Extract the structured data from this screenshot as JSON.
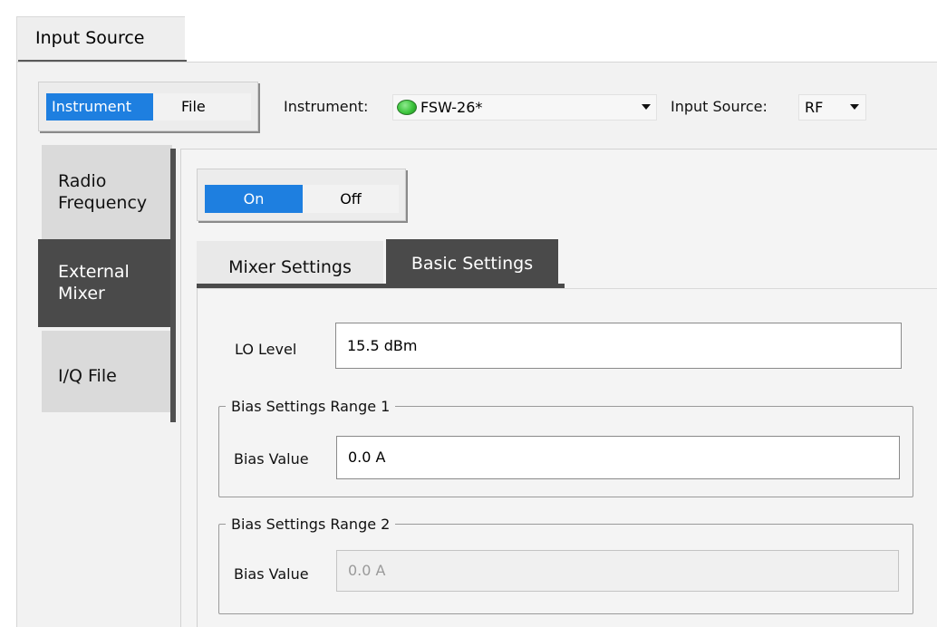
{
  "window": {
    "main_tab": "Input Source"
  },
  "source_toggle": {
    "options": [
      "Instrument",
      "File"
    ],
    "selected": "Instrument"
  },
  "instrument_select": {
    "label": "Instrument:",
    "value": "FSW-26*",
    "status_color": "#3cc43c"
  },
  "input_source_select": {
    "label": "Input Source:",
    "value": "RF"
  },
  "side_tabs": [
    {
      "label_line1": "Radio",
      "label_line2": "Frequency",
      "active": false
    },
    {
      "label_line1": "External",
      "label_line2": "Mixer",
      "active": true
    },
    {
      "label_line1": "I/Q File",
      "label_line2": "",
      "active": false
    }
  ],
  "state_toggle": {
    "options": [
      "On",
      "Off"
    ],
    "selected": "On"
  },
  "sub_tabs": [
    {
      "label": "Mixer Settings",
      "active": false
    },
    {
      "label": "Basic Settings",
      "active": true
    }
  ],
  "basic_settings": {
    "lo_level": {
      "label": "LO Level",
      "value": "15.5 dBm"
    },
    "bias_range_1": {
      "title": "Bias Settings Range 1",
      "label": "Bias Value",
      "value": "0.0 A",
      "enabled": true
    },
    "bias_range_2": {
      "title": "Bias Settings Range 2",
      "label": "Bias Value",
      "value": "0.0 A",
      "enabled": false
    }
  },
  "colors": {
    "accent": "#1e7fe0",
    "active_tab": "#4a4a4a",
    "panel_bg": "#f2f2f2"
  }
}
